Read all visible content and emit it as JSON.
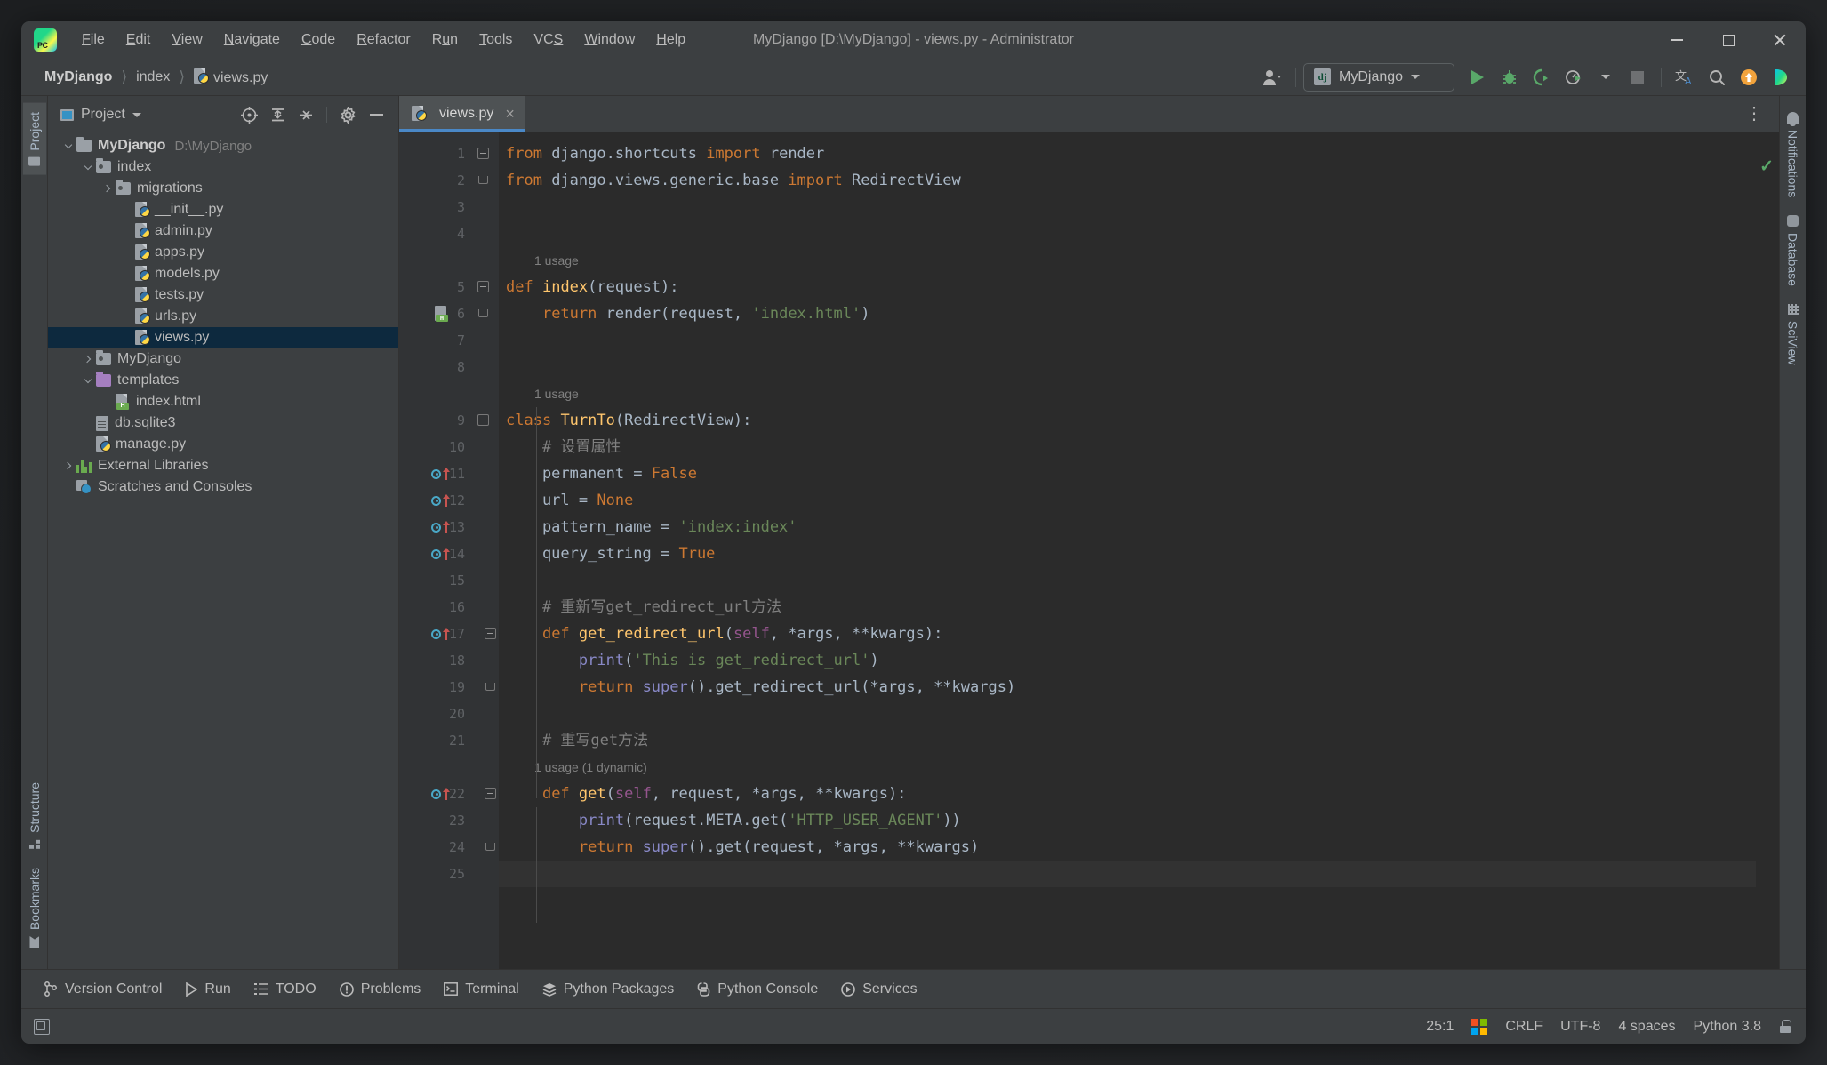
{
  "window": {
    "title": "MyDjango [D:\\MyDjango] - views.py - Administrator",
    "logo_text": "PC",
    "controls": {
      "minimize": "minimize-icon",
      "maximize": "maximize-icon",
      "close": "close-icon"
    }
  },
  "menubar": {
    "items": [
      {
        "label": "File",
        "mnemonic": "F"
      },
      {
        "label": "Edit",
        "mnemonic": "E"
      },
      {
        "label": "View",
        "mnemonic": "V"
      },
      {
        "label": "Navigate",
        "mnemonic": "N"
      },
      {
        "label": "Code",
        "mnemonic": "C"
      },
      {
        "label": "Refactor",
        "mnemonic": "R"
      },
      {
        "label": "Run",
        "mnemonic": "u"
      },
      {
        "label": "Tools",
        "mnemonic": "T"
      },
      {
        "label": "VCS",
        "mnemonic": "S"
      },
      {
        "label": "Window",
        "mnemonic": "W"
      },
      {
        "label": "Help",
        "mnemonic": "H"
      }
    ]
  },
  "navbar": {
    "breadcrumbs": [
      {
        "label": "MyDjango",
        "icon": null
      },
      {
        "label": "index",
        "icon": null
      },
      {
        "label": "views.py",
        "icon": "python-file-icon"
      }
    ],
    "run_config": {
      "label": "MyDjango",
      "icon": "django-icon"
    },
    "actions": [
      {
        "name": "account-icon",
        "label": ""
      },
      {
        "name": "run-icon",
        "label": ""
      },
      {
        "name": "debug-icon",
        "label": ""
      },
      {
        "name": "run-with-coverage-icon",
        "label": ""
      },
      {
        "name": "profiler-icon",
        "label": ""
      },
      {
        "name": "stop-icon",
        "label": ""
      },
      {
        "name": "translate-icon",
        "label": ""
      },
      {
        "name": "search-everywhere-icon",
        "label": ""
      },
      {
        "name": "update-icon",
        "label": ""
      },
      {
        "name": "ide-feature-icon",
        "label": ""
      }
    ]
  },
  "left_strip": {
    "tabs": [
      {
        "label": "Project",
        "icon": "folder-icon",
        "active": true
      },
      {
        "label": "Structure",
        "icon": "structure-icon",
        "active": false
      },
      {
        "label": "Bookmarks",
        "icon": "bookmark-icon",
        "active": false
      }
    ]
  },
  "right_strip": {
    "tabs": [
      {
        "label": "Notifications",
        "icon": "bell-icon"
      },
      {
        "label": "Database",
        "icon": "database-icon"
      },
      {
        "label": "SciView",
        "icon": "grid-icon"
      }
    ]
  },
  "project_panel": {
    "title": "Project",
    "tools": [
      {
        "name": "select-opened-file-icon"
      },
      {
        "name": "expand-all-icon"
      },
      {
        "name": "collapse-all-icon"
      },
      {
        "name": "settings-gear-icon"
      },
      {
        "name": "hide-panel-icon"
      }
    ],
    "tree": [
      {
        "label": "MyDjango",
        "sub": "D:\\MyDjango",
        "depth": 0,
        "icon": "folder-icon",
        "arrow": "down",
        "bold": true,
        "selected": false
      },
      {
        "label": "index",
        "sub": "",
        "depth": 1,
        "icon": "folder-source-icon",
        "arrow": "down",
        "bold": false,
        "selected": false
      },
      {
        "label": "migrations",
        "sub": "",
        "depth": 2,
        "icon": "folder-source-icon",
        "arrow": "right",
        "bold": false,
        "selected": false
      },
      {
        "label": "__init__.py",
        "sub": "",
        "depth": 3,
        "icon": "python-file-icon",
        "arrow": "none",
        "bold": false,
        "selected": false
      },
      {
        "label": "admin.py",
        "sub": "",
        "depth": 3,
        "icon": "python-file-icon",
        "arrow": "none",
        "bold": false,
        "selected": false
      },
      {
        "label": "apps.py",
        "sub": "",
        "depth": 3,
        "icon": "python-file-icon",
        "arrow": "none",
        "bold": false,
        "selected": false
      },
      {
        "label": "models.py",
        "sub": "",
        "depth": 3,
        "icon": "python-file-icon",
        "arrow": "none",
        "bold": false,
        "selected": false
      },
      {
        "label": "tests.py",
        "sub": "",
        "depth": 3,
        "icon": "python-file-icon",
        "arrow": "none",
        "bold": false,
        "selected": false
      },
      {
        "label": "urls.py",
        "sub": "",
        "depth": 3,
        "icon": "python-file-icon",
        "arrow": "none",
        "bold": false,
        "selected": false
      },
      {
        "label": "views.py",
        "sub": "",
        "depth": 3,
        "icon": "python-file-icon",
        "arrow": "none",
        "bold": false,
        "selected": true
      },
      {
        "label": "MyDjango",
        "sub": "",
        "depth": 1,
        "icon": "folder-source-icon",
        "arrow": "right",
        "bold": false,
        "selected": false
      },
      {
        "label": "templates",
        "sub": "",
        "depth": 1,
        "icon": "folder-template-icon",
        "arrow": "down",
        "bold": false,
        "selected": false
      },
      {
        "label": "index.html",
        "sub": "",
        "depth": 2,
        "icon": "html-file-icon",
        "arrow": "none",
        "bold": false,
        "selected": false
      },
      {
        "label": "db.sqlite3",
        "sub": "",
        "depth": 1,
        "icon": "db-file-icon",
        "arrow": "none",
        "bold": false,
        "selected": false
      },
      {
        "label": "manage.py",
        "sub": "",
        "depth": 1,
        "icon": "python-file-icon",
        "arrow": "none",
        "bold": false,
        "selected": false
      },
      {
        "label": "External Libraries",
        "sub": "",
        "depth": 0,
        "icon": "library-icon",
        "arrow": "right",
        "bold": false,
        "selected": false
      },
      {
        "label": "Scratches and Consoles",
        "sub": "",
        "depth": 0,
        "icon": "scratch-icon",
        "arrow": "none",
        "bold": false,
        "selected": false
      }
    ]
  },
  "editor": {
    "tabs": [
      {
        "label": "views.py",
        "icon": "python-file-icon",
        "active": true,
        "close": "×"
      }
    ],
    "options_icon": "⋮",
    "inspection_status": "✓",
    "lines": [
      {
        "no": "1",
        "fold": "start",
        "gutter": "",
        "text": "from django.shortcuts import render"
      },
      {
        "no": "2",
        "fold": "end",
        "gutter": "",
        "text": "from django.views.generic.base import RedirectView"
      },
      {
        "no": "3",
        "fold": "",
        "gutter": "",
        "text": ""
      },
      {
        "no": "4",
        "fold": "",
        "gutter": "",
        "text": ""
      },
      {
        "no": "",
        "fold": "",
        "gutter": "",
        "text": "1 usage",
        "hint": true
      },
      {
        "no": "5",
        "fold": "start",
        "gutter": "",
        "text": "def index(request):"
      },
      {
        "no": "6",
        "fold": "end",
        "gutter": "html-file-icon",
        "text": "    return render(request, 'index.html')"
      },
      {
        "no": "7",
        "fold": "",
        "gutter": "",
        "text": ""
      },
      {
        "no": "8",
        "fold": "",
        "gutter": "",
        "text": ""
      },
      {
        "no": "",
        "fold": "",
        "gutter": "",
        "text": "1 usage",
        "hint": true
      },
      {
        "no": "9",
        "fold": "start",
        "gutter": "",
        "text": "class TurnTo(RedirectView):"
      },
      {
        "no": "10",
        "fold": "",
        "gutter": "",
        "text": "    # 设置属性"
      },
      {
        "no": "11",
        "fold": "",
        "gutter": "override",
        "text": "    permanent = False"
      },
      {
        "no": "12",
        "fold": "",
        "gutter": "override",
        "text": "    url = None"
      },
      {
        "no": "13",
        "fold": "",
        "gutter": "override",
        "text": "    pattern_name = 'index:index'"
      },
      {
        "no": "14",
        "fold": "",
        "gutter": "override",
        "text": "    query_string = True"
      },
      {
        "no": "15",
        "fold": "",
        "gutter": "",
        "text": ""
      },
      {
        "no": "16",
        "fold": "",
        "gutter": "",
        "text": "    # 重新写get_redirect_url方法"
      },
      {
        "no": "17",
        "fold": "start2",
        "gutter": "override",
        "text": "    def get_redirect_url(self, *args, **kwargs):"
      },
      {
        "no": "18",
        "fold": "",
        "gutter": "",
        "text": "        print('This is get_redirect_url')"
      },
      {
        "no": "19",
        "fold": "end2",
        "gutter": "",
        "text": "        return super().get_redirect_url(*args, **kwargs)"
      },
      {
        "no": "20",
        "fold": "",
        "gutter": "",
        "text": ""
      },
      {
        "no": "21",
        "fold": "",
        "gutter": "",
        "text": "    # 重写get方法"
      },
      {
        "no": "",
        "fold": "",
        "gutter": "",
        "text": "1 usage (1 dynamic)",
        "hint": true
      },
      {
        "no": "22",
        "fold": "start2",
        "gutter": "override",
        "text": "    def get(self, request, *args, **kwargs):"
      },
      {
        "no": "23",
        "fold": "",
        "gutter": "",
        "text": "        print(request.META.get('HTTP_USER_AGENT'))"
      },
      {
        "no": "24",
        "fold": "end2",
        "gutter": "",
        "text": "        return super().get(request, *args, **kwargs)"
      },
      {
        "no": "25",
        "fold": "",
        "gutter": "",
        "text": "",
        "current": true
      }
    ]
  },
  "toolwindow_bar": {
    "buttons": [
      {
        "label": "Version Control",
        "icon": "branch-icon"
      },
      {
        "label": "Run",
        "icon": "run-icon"
      },
      {
        "label": "TODO",
        "icon": "list-icon"
      },
      {
        "label": "Problems",
        "icon": "warning-icon"
      },
      {
        "label": "Terminal",
        "icon": "terminal-icon"
      },
      {
        "label": "Python Packages",
        "icon": "packages-icon"
      },
      {
        "label": "Python Console",
        "icon": "python-icon"
      },
      {
        "label": "Services",
        "icon": "services-icon"
      }
    ]
  },
  "statusbar": {
    "left_icon": "show-tool-windows-icon",
    "caret_position": "25:1",
    "os_icon": "windows-icon",
    "line_separator": "CRLF",
    "encoding": "UTF-8",
    "indent": "4 spaces",
    "interpreter": "Python 3.8",
    "lock_icon": "unlocked-icon"
  },
  "colors": {
    "bg_panel": "#3c3f41",
    "bg_editor": "#2b2b2b",
    "bg_gutter": "#313335",
    "accent_blue": "#4a88c7",
    "selection": "#0d293e",
    "keyword": "#cc7832",
    "string": "#6a8759",
    "function": "#ffc66d",
    "comment": "#808080",
    "number": "#6897bb",
    "self": "#94558d",
    "builtin": "#8888c6",
    "text": "#a9b7c6",
    "success_green": "#59a869"
  }
}
